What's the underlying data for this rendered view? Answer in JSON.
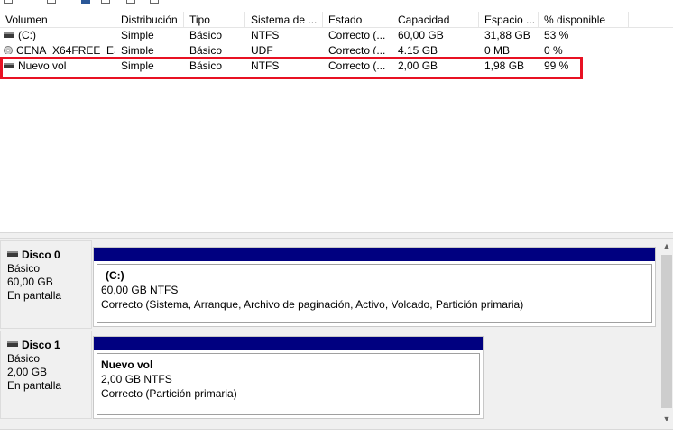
{
  "columns": [
    "Volumen",
    "Distribución",
    "Tipo",
    "Sistema de ...",
    "Estado",
    "Capacidad",
    "Espacio ...",
    "% disponible"
  ],
  "volumes": [
    {
      "icon": "volume-icon",
      "name": "(C:)",
      "layout": "Simple",
      "type": "Básico",
      "fs": "NTFS",
      "status": "Correcto (...",
      "capacity": "60,00 GB",
      "free": "31,88 GB",
      "pct": "53 %"
    },
    {
      "icon": "cd-icon",
      "name": "CENA_X64FREE_ES...",
      "layout": "Simple",
      "type": "Básico",
      "fs": "UDF",
      "status": "Correcto (...",
      "capacity": "4,15 GB",
      "free": "0 MB",
      "pct": "0 %"
    },
    {
      "icon": "volume-icon",
      "name": "Nuevo vol",
      "layout": "Simple",
      "type": "Básico",
      "fs": "NTFS",
      "status": "Correcto (...",
      "capacity": "2,00 GB",
      "free": "1,98 GB",
      "pct": "99 %"
    }
  ],
  "highlight_color": "#e81123",
  "partition_bar_color": "#000080",
  "disks": [
    {
      "name": "Disco 0",
      "type": "Básico",
      "size": "60,00 GB",
      "state": "En pantalla",
      "partition": {
        "name": "(C:)",
        "size_fs": "60,00 GB NTFS",
        "status": "Correcto (Sistema, Arranque, Archivo de paginación, Activo, Volcado, Partición primaria)"
      }
    },
    {
      "name": "Disco 1",
      "type": "Básico",
      "size": "2,00 GB",
      "state": "En pantalla",
      "partition": {
        "name": "Nuevo vol",
        "size_fs": "2,00 GB NTFS",
        "status": "Correcto (Partición primaria)"
      }
    }
  ]
}
